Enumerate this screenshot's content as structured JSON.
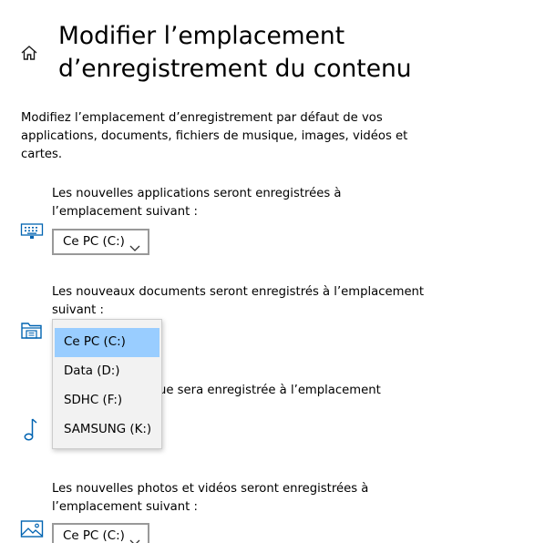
{
  "page": {
    "title": "Modifier l’emplacement d’enregistrement du contenu",
    "description": "Modifiez l’emplacement d’enregistrement par défaut de vos applications, documents, fichiers de musique, images, vidéos et cartes."
  },
  "sections": {
    "apps": {
      "label": "Les nouvelles applications seront enregistrées à l’emplacement suivant :",
      "value": "Ce PC (C:)",
      "icon": "keyboard-icon"
    },
    "documents": {
      "label": "Les nouveaux documents seront enregistrés à l’emplacement suivant :",
      "icon": "folder-icon"
    },
    "music": {
      "label_visible_fragment": "ue sera enregistrée à l’emplacement",
      "icon": "music-note-icon"
    },
    "photos": {
      "label": "Les nouvelles photos et vidéos seront enregistrées à l’emplacement suivant :",
      "value": "Ce PC (C:)",
      "icon": "picture-icon"
    }
  },
  "dropdown": {
    "options": [
      "Ce PC (C:)",
      "Data (D:)",
      "SDHC (F:)",
      "SAMSUNG (K:)"
    ],
    "selected_index": 0
  },
  "colors": {
    "accent_icon": "#0063b1",
    "selected_option": "#99cdff",
    "dropdown_bg": "#f2f2f2",
    "select_border": "#999999"
  }
}
